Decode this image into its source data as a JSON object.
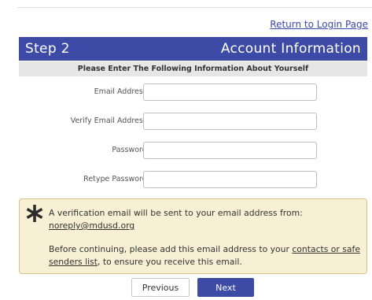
{
  "links": {
    "return_to_login": "Return to Login Page"
  },
  "header": {
    "step": "Step 2",
    "title": "Account Information",
    "color": "#3d4aa6"
  },
  "subheader": "Please Enter The Following Information About Yourself",
  "form": {
    "email_label": "Email Address:",
    "verify_email_label": "Verify Email Address:",
    "password_label": "Password:",
    "retype_password_label": "Retype Password:",
    "email_value": "",
    "verify_email_value": "",
    "password_value": "",
    "retype_password_value": ""
  },
  "notice": {
    "icon": "asterisk-icon",
    "color": "#f7f0d4",
    "line1_text": "A verification email will be sent to your email address from: ",
    "sender_email": "noreply@mdusd.org",
    "line2_prefix": "Before continuing, please add this email address to your ",
    "contacts_link": "contacts or safe senders list",
    "line2_suffix": ", to ensure you receive this email."
  },
  "buttons": {
    "previous": "Previous",
    "next": "Next"
  }
}
